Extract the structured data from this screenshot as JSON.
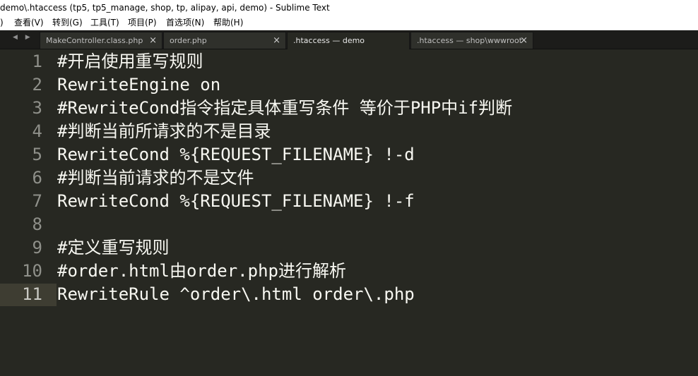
{
  "window": {
    "title": "demo\\.htaccess (tp5, tp5_manage, shop, tp, alipay, api, demo) - Sublime Text"
  },
  "menu": [
    {
      "label": ")"
    },
    {
      "label": "查看(V)"
    },
    {
      "label": "转到(G)"
    },
    {
      "label": "工具(T)"
    },
    {
      "label": "项目(P)"
    },
    {
      "label": "首选项(N)"
    },
    {
      "label": "帮助(H)"
    }
  ],
  "tabs": [
    {
      "label": "MakeController.class.php",
      "close": "×"
    },
    {
      "label": "order.php",
      "close": "×"
    },
    {
      "label": ".htaccess — demo",
      "close": ""
    },
    {
      "label": ".htaccess — shop\\wwwroot",
      "close": "×"
    }
  ],
  "nav_arrows": "◀ ▶",
  "editor": {
    "current_line": 11,
    "lines": [
      {
        "n": "1",
        "text": "#开启使用重写规则"
      },
      {
        "n": "2",
        "text": "RewriteEngine on"
      },
      {
        "n": "3",
        "text": "#RewriteCond指令指定具体重写条件 等价于PHP中if判断"
      },
      {
        "n": "4",
        "text": "#判断当前所请求的不是目录"
      },
      {
        "n": "5",
        "text": "RewriteCond %{REQUEST_FILENAME} !-d"
      },
      {
        "n": "6",
        "text": "#判断当前请求的不是文件"
      },
      {
        "n": "7",
        "text": "RewriteCond %{REQUEST_FILENAME} !-f"
      },
      {
        "n": "8",
        "text": ""
      },
      {
        "n": "9",
        "text": "#定义重写规则"
      },
      {
        "n": "10",
        "text": "#order.html由order.php进行解析"
      },
      {
        "n": "11",
        "text": "RewriteRule ^order\\.html order\\.php"
      }
    ]
  },
  "colors": {
    "editor_bg": "#272822",
    "text": "#f8f8f2",
    "gutter_text": "#8f908a",
    "current_line": "#3e3d32"
  }
}
